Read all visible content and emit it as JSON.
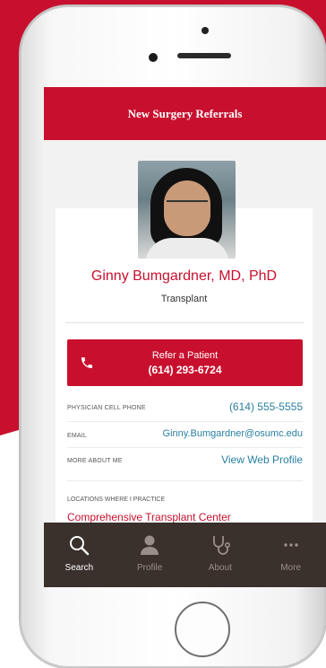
{
  "header": {
    "title": "New Surgery Referrals"
  },
  "profile": {
    "name": "Ginny Bumgardner, MD, PhD",
    "department": "Transplant"
  },
  "refer": {
    "label": "Refer a Patient",
    "phone": "(614) 293-6724"
  },
  "details": [
    {
      "key": "PHYSICIAN CELL PHONE",
      "value": "(614) 555-5555"
    },
    {
      "key": "EMAIL",
      "value": "Ginny.Bumgardner@osumc.edu"
    },
    {
      "key": "MORE ABOUT ME",
      "value": "View Web Profile"
    }
  ],
  "locations": {
    "label": "LOCATIONS WHERE I PRACTICE",
    "first": "Comprehensive Transplant Center"
  },
  "tabs": [
    {
      "label": "Search",
      "icon": "search-icon",
      "active": true
    },
    {
      "label": "Profile",
      "icon": "person-icon",
      "active": false
    },
    {
      "label": "About",
      "icon": "stethoscope-icon",
      "active": false
    },
    {
      "label": "More",
      "icon": "more-icon",
      "active": false
    }
  ],
  "colors": {
    "brand_red": "#c8102e",
    "link_blue": "#2a7fa0",
    "tabbar": "#3a302c"
  }
}
